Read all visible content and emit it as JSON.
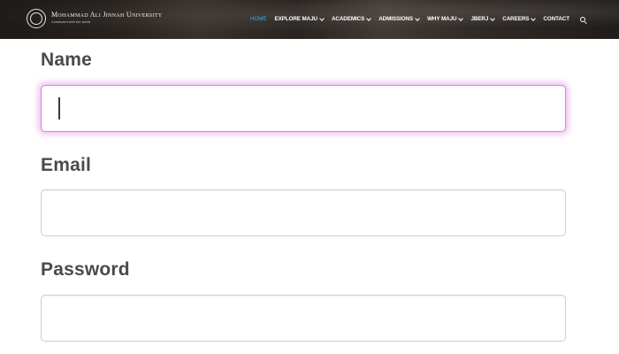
{
  "header": {
    "brand_name": "Mohammad Ali Jinnah University",
    "brand_tagline": "Connected with the world",
    "nav_items": [
      {
        "label": "HOME",
        "dropdown": false
      },
      {
        "label": "EXPLORE MAJU",
        "dropdown": true
      },
      {
        "label": "ACADEMICS",
        "dropdown": true
      },
      {
        "label": "ADMISSIONS",
        "dropdown": true
      },
      {
        "label": "WHY MAJU",
        "dropdown": true
      },
      {
        "label": "JBERJ",
        "dropdown": true
      },
      {
        "label": "CAREERS",
        "dropdown": true
      },
      {
        "label": "CONTACT",
        "dropdown": false
      }
    ],
    "active_color": "#2ab3e6",
    "search_icon": "search-icon"
  },
  "form": {
    "name_label": "Name",
    "name_value": "",
    "email_label": "Email",
    "email_value": "",
    "password_label": "Password",
    "password_value": "",
    "focus_color": "#d68ad8"
  }
}
